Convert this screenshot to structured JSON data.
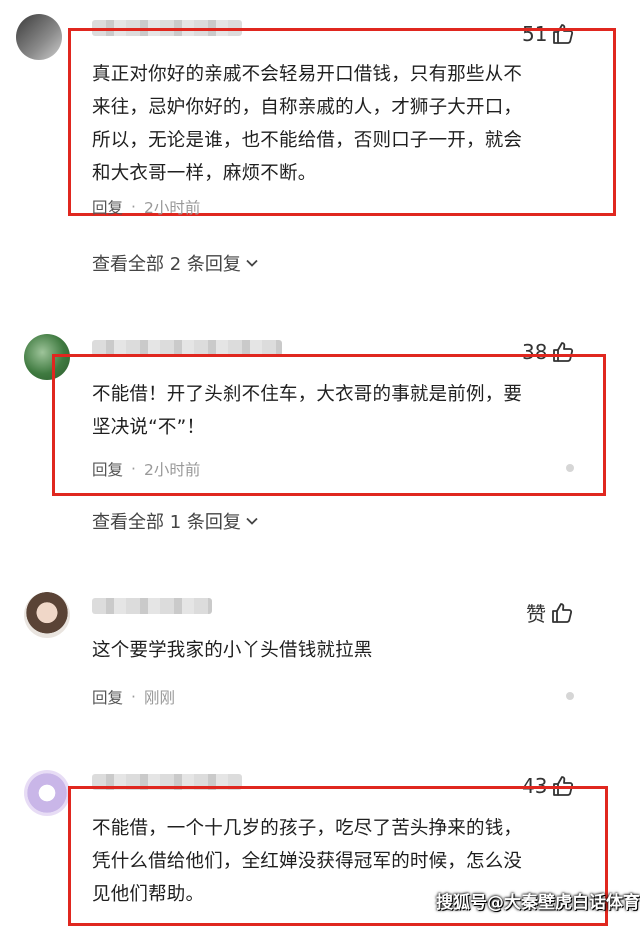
{
  "comments": [
    {
      "likes": "51",
      "text_lines": [
        "真正对你好的亲戚不会轻易开口借钱，只有那些从不",
        "来往，忌妒你好的，自称亲戚的人，才狮子大开口，",
        "所以，无论是谁，也不能给借，否则口子一开，就会",
        "和大衣哥一样，麻烦不断。"
      ],
      "reply_label": "回复",
      "time": "2小时前",
      "expand_label": "查看全部 2 条回复"
    },
    {
      "likes": "38",
      "text_lines": [
        "不能借！开了头刹不住车，大衣哥的事就是前例，要",
        "坚决说“不”！"
      ],
      "reply_label": "回复",
      "time": "2小时前",
      "expand_label": "查看全部 1 条回复"
    },
    {
      "likes": "赞",
      "text_lines": [
        "这个要学我家的小丫头借钱就拉黑"
      ],
      "reply_label": "回复",
      "time": "刚刚"
    },
    {
      "likes": "43",
      "text_lines": [
        "不能借，一个十几岁的孩子，吃尽了苦头挣来的钱，",
        "凭什么借给他们，全红婵没获得冠军的时候，怎么没",
        "见他们帮助。"
      ]
    }
  ],
  "watermark": "搜狐号@大秦壁虎白话体育",
  "colors": {
    "highlight": "#e0271f",
    "text": "#1f1f1f",
    "meta": "#999999"
  }
}
